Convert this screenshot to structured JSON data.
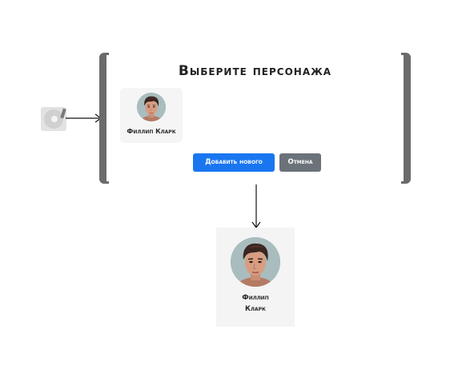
{
  "spinner": {
    "icon": "loading-spinner-icon"
  },
  "dialog": {
    "title": "Выберите персонажа",
    "characters": [
      {
        "name": "Филлип Кларк",
        "avatar_icon": "character-portrait"
      }
    ],
    "buttons": {
      "add_new_label": "Добавить нового",
      "cancel_label": "Отмена"
    }
  },
  "selected_character": {
    "name_line1": "Филлип",
    "name_line2": "Кларк",
    "avatar_icon": "character-portrait"
  },
  "colors": {
    "primary_button": "#1976f0",
    "secondary_button": "#6c727a",
    "bracket": "#6b6b6b",
    "card_bg": "#f4f4f4"
  }
}
